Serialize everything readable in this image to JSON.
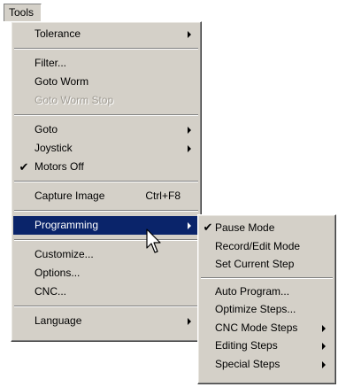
{
  "menubar": {
    "tools_label": "Tools"
  },
  "tools_menu": {
    "groups": [
      [
        {
          "label": "Tolerance",
          "submenu": true
        }
      ],
      [
        {
          "label": "Filter..."
        },
        {
          "label": "Goto Worm"
        },
        {
          "label": "Goto Worm Stop",
          "disabled": true
        }
      ],
      [
        {
          "label": "Goto",
          "submenu": true
        },
        {
          "label": "Joystick",
          "submenu": true
        },
        {
          "label": "Motors Off",
          "checked": true
        }
      ],
      [
        {
          "label": "Capture Image",
          "shortcut": "Ctrl+F8"
        }
      ],
      [
        {
          "label": "Programming",
          "submenu": true,
          "highlighted": true
        }
      ],
      [
        {
          "label": "Customize..."
        },
        {
          "label": "Options..."
        },
        {
          "label": "CNC..."
        }
      ],
      [
        {
          "label": "Language",
          "submenu": true
        }
      ]
    ]
  },
  "programming_submenu": {
    "groups": [
      [
        {
          "label": "Pause Mode",
          "checked": true
        },
        {
          "label": "Record/Edit Mode"
        },
        {
          "label": "Set Current Step"
        }
      ],
      [
        {
          "label": "Auto Program..."
        },
        {
          "label": "Optimize Steps..."
        },
        {
          "label": "CNC Mode Steps",
          "submenu": true
        },
        {
          "label": "Editing Steps",
          "submenu": true
        },
        {
          "label": "Special Steps",
          "submenu": true
        }
      ]
    ]
  },
  "glyphs": {
    "check": "✔"
  },
  "colors": {
    "menu_face": "#d4d0c8",
    "highlight": "#0a246a",
    "highlight_text": "#ffffff",
    "disabled_text": "#a09c94"
  }
}
